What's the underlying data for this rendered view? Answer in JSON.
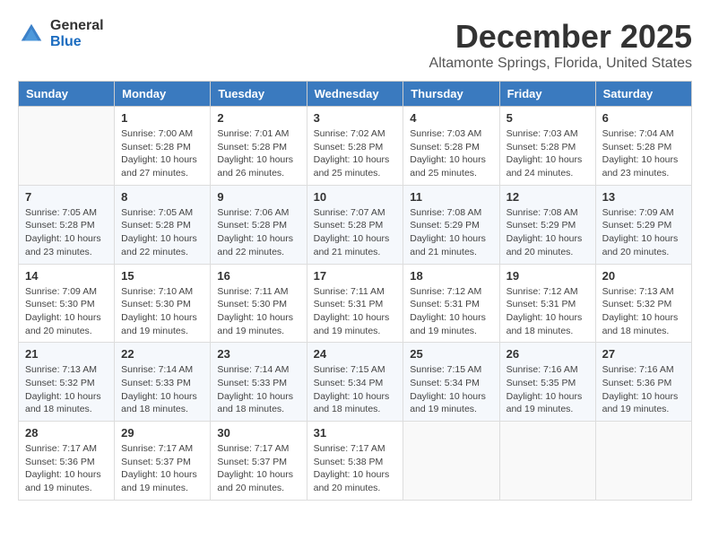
{
  "header": {
    "logo_general": "General",
    "logo_blue": "Blue",
    "month_title": "December 2025",
    "location": "Altamonte Springs, Florida, United States"
  },
  "calendar": {
    "weekdays": [
      "Sunday",
      "Monday",
      "Tuesday",
      "Wednesday",
      "Thursday",
      "Friday",
      "Saturday"
    ],
    "weeks": [
      [
        {
          "day": "",
          "info": ""
        },
        {
          "day": "1",
          "info": "Sunrise: 7:00 AM\nSunset: 5:28 PM\nDaylight: 10 hours\nand 27 minutes."
        },
        {
          "day": "2",
          "info": "Sunrise: 7:01 AM\nSunset: 5:28 PM\nDaylight: 10 hours\nand 26 minutes."
        },
        {
          "day": "3",
          "info": "Sunrise: 7:02 AM\nSunset: 5:28 PM\nDaylight: 10 hours\nand 25 minutes."
        },
        {
          "day": "4",
          "info": "Sunrise: 7:03 AM\nSunset: 5:28 PM\nDaylight: 10 hours\nand 25 minutes."
        },
        {
          "day": "5",
          "info": "Sunrise: 7:03 AM\nSunset: 5:28 PM\nDaylight: 10 hours\nand 24 minutes."
        },
        {
          "day": "6",
          "info": "Sunrise: 7:04 AM\nSunset: 5:28 PM\nDaylight: 10 hours\nand 23 minutes."
        }
      ],
      [
        {
          "day": "7",
          "info": "Sunrise: 7:05 AM\nSunset: 5:28 PM\nDaylight: 10 hours\nand 23 minutes."
        },
        {
          "day": "8",
          "info": "Sunrise: 7:05 AM\nSunset: 5:28 PM\nDaylight: 10 hours\nand 22 minutes."
        },
        {
          "day": "9",
          "info": "Sunrise: 7:06 AM\nSunset: 5:28 PM\nDaylight: 10 hours\nand 22 minutes."
        },
        {
          "day": "10",
          "info": "Sunrise: 7:07 AM\nSunset: 5:28 PM\nDaylight: 10 hours\nand 21 minutes."
        },
        {
          "day": "11",
          "info": "Sunrise: 7:08 AM\nSunset: 5:29 PM\nDaylight: 10 hours\nand 21 minutes."
        },
        {
          "day": "12",
          "info": "Sunrise: 7:08 AM\nSunset: 5:29 PM\nDaylight: 10 hours\nand 20 minutes."
        },
        {
          "day": "13",
          "info": "Sunrise: 7:09 AM\nSunset: 5:29 PM\nDaylight: 10 hours\nand 20 minutes."
        }
      ],
      [
        {
          "day": "14",
          "info": "Sunrise: 7:09 AM\nSunset: 5:30 PM\nDaylight: 10 hours\nand 20 minutes."
        },
        {
          "day": "15",
          "info": "Sunrise: 7:10 AM\nSunset: 5:30 PM\nDaylight: 10 hours\nand 19 minutes."
        },
        {
          "day": "16",
          "info": "Sunrise: 7:11 AM\nSunset: 5:30 PM\nDaylight: 10 hours\nand 19 minutes."
        },
        {
          "day": "17",
          "info": "Sunrise: 7:11 AM\nSunset: 5:31 PM\nDaylight: 10 hours\nand 19 minutes."
        },
        {
          "day": "18",
          "info": "Sunrise: 7:12 AM\nSunset: 5:31 PM\nDaylight: 10 hours\nand 19 minutes."
        },
        {
          "day": "19",
          "info": "Sunrise: 7:12 AM\nSunset: 5:31 PM\nDaylight: 10 hours\nand 18 minutes."
        },
        {
          "day": "20",
          "info": "Sunrise: 7:13 AM\nSunset: 5:32 PM\nDaylight: 10 hours\nand 18 minutes."
        }
      ],
      [
        {
          "day": "21",
          "info": "Sunrise: 7:13 AM\nSunset: 5:32 PM\nDaylight: 10 hours\nand 18 minutes."
        },
        {
          "day": "22",
          "info": "Sunrise: 7:14 AM\nSunset: 5:33 PM\nDaylight: 10 hours\nand 18 minutes."
        },
        {
          "day": "23",
          "info": "Sunrise: 7:14 AM\nSunset: 5:33 PM\nDaylight: 10 hours\nand 18 minutes."
        },
        {
          "day": "24",
          "info": "Sunrise: 7:15 AM\nSunset: 5:34 PM\nDaylight: 10 hours\nand 18 minutes."
        },
        {
          "day": "25",
          "info": "Sunrise: 7:15 AM\nSunset: 5:34 PM\nDaylight: 10 hours\nand 19 minutes."
        },
        {
          "day": "26",
          "info": "Sunrise: 7:16 AM\nSunset: 5:35 PM\nDaylight: 10 hours\nand 19 minutes."
        },
        {
          "day": "27",
          "info": "Sunrise: 7:16 AM\nSunset: 5:36 PM\nDaylight: 10 hours\nand 19 minutes."
        }
      ],
      [
        {
          "day": "28",
          "info": "Sunrise: 7:17 AM\nSunset: 5:36 PM\nDaylight: 10 hours\nand 19 minutes."
        },
        {
          "day": "29",
          "info": "Sunrise: 7:17 AM\nSunset: 5:37 PM\nDaylight: 10 hours\nand 19 minutes."
        },
        {
          "day": "30",
          "info": "Sunrise: 7:17 AM\nSunset: 5:37 PM\nDaylight: 10 hours\nand 20 minutes."
        },
        {
          "day": "31",
          "info": "Sunrise: 7:17 AM\nSunset: 5:38 PM\nDaylight: 10 hours\nand 20 minutes."
        },
        {
          "day": "",
          "info": ""
        },
        {
          "day": "",
          "info": ""
        },
        {
          "day": "",
          "info": ""
        }
      ]
    ]
  }
}
